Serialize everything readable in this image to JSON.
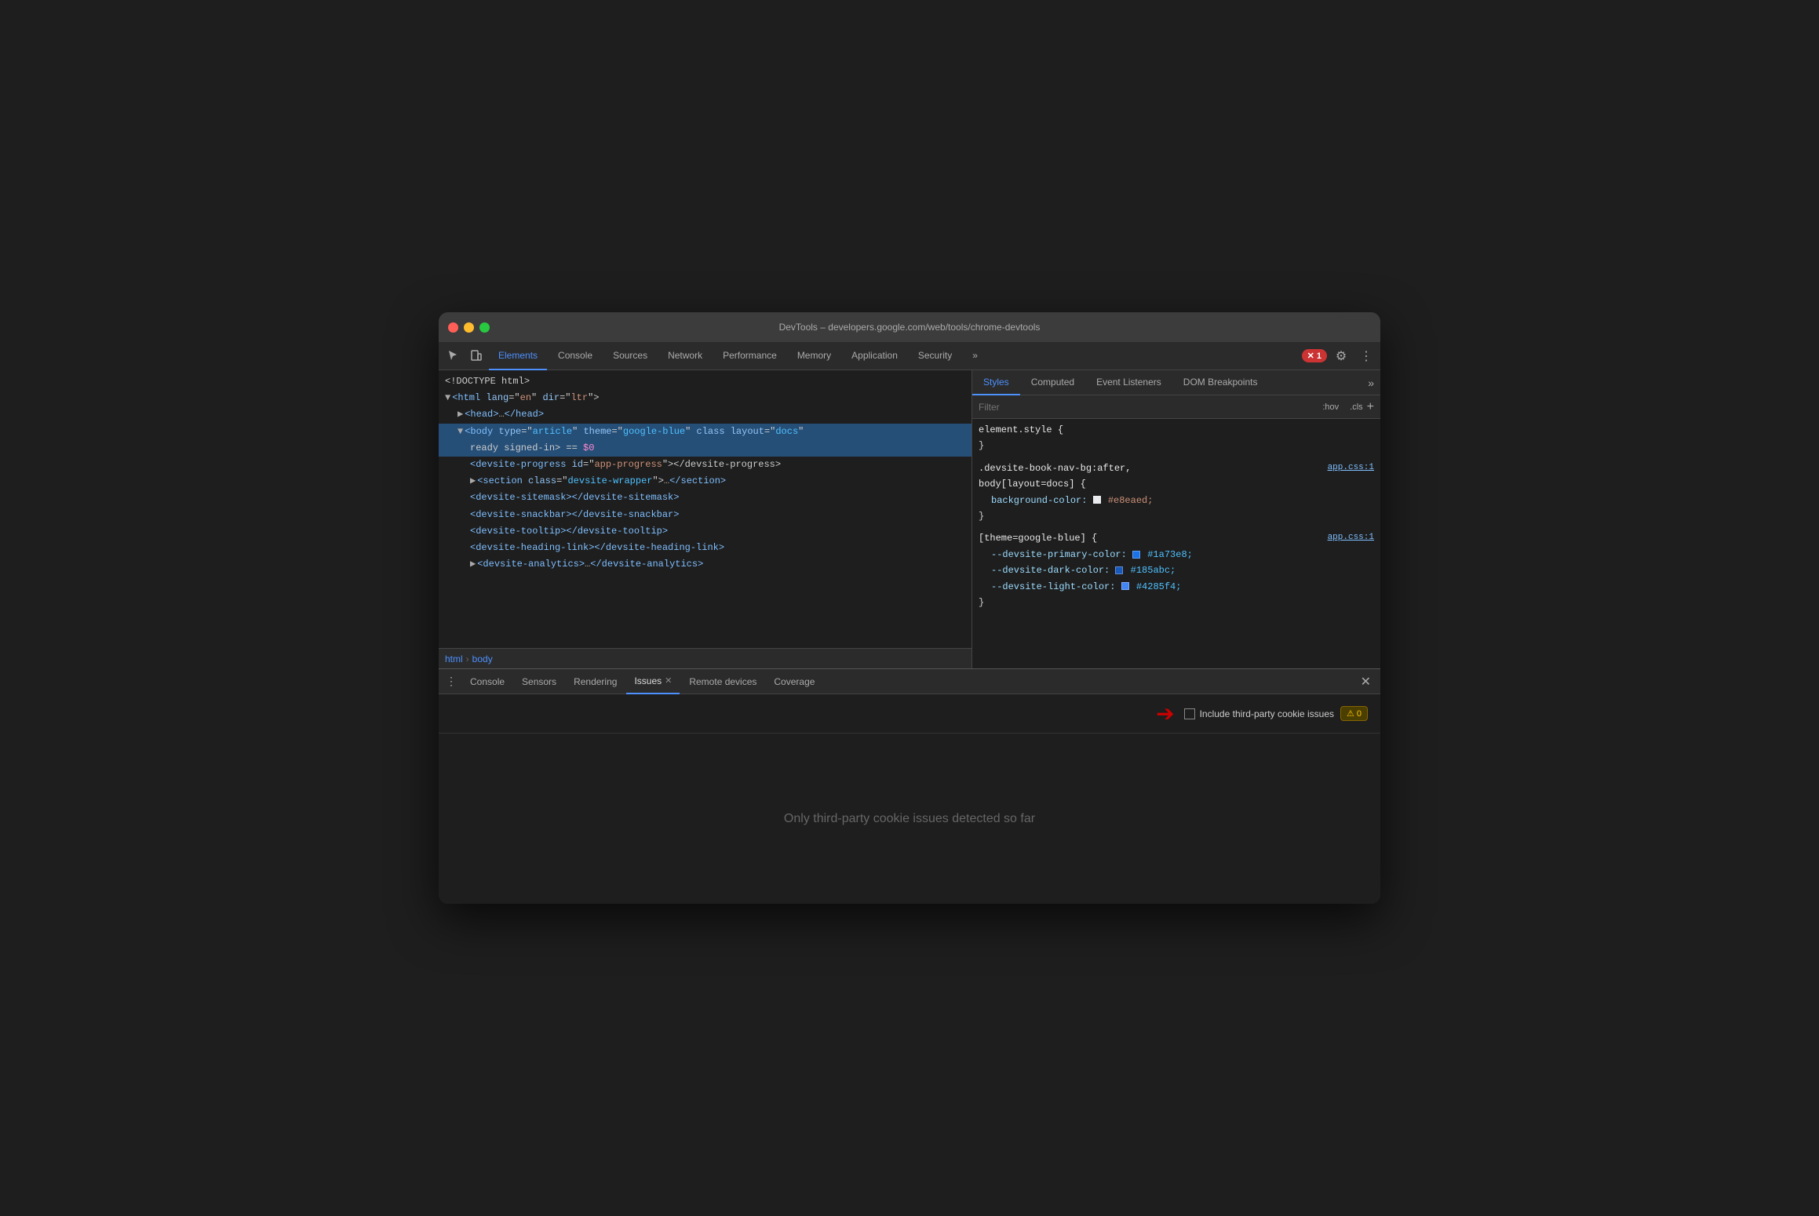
{
  "window": {
    "title": "DevTools – developers.google.com/web/tools/chrome-devtools"
  },
  "nav": {
    "tabs": [
      {
        "label": "Elements",
        "active": true
      },
      {
        "label": "Console",
        "active": false
      },
      {
        "label": "Sources",
        "active": false
      },
      {
        "label": "Network",
        "active": false
      },
      {
        "label": "Performance",
        "active": false
      },
      {
        "label": "Memory",
        "active": false
      },
      {
        "label": "Application",
        "active": false
      },
      {
        "label": "Security",
        "active": false
      }
    ],
    "more_label": "»",
    "error_count": "1",
    "settings_icon": "⚙",
    "more_vert_icon": "⋮"
  },
  "elements": {
    "lines": [
      {
        "text": "<!DOCTYPE html>",
        "type": "doctype",
        "indent": 0
      },
      {
        "text": "<html lang=\"en\" dir=\"ltr\">",
        "type": "tag",
        "indent": 0,
        "has_triangle": true,
        "triangle_open": true
      },
      {
        "text": "▶ <head>…</head>",
        "type": "tag_collapsed",
        "indent": 1
      },
      {
        "text": "<body type=\"article\" theme=\"google-blue\" class layout=\"docs\"",
        "type": "tag_selected",
        "indent": 1,
        "has_triangle": true,
        "triangle_open": true
      },
      {
        "text": "ready signed-in> == $0",
        "type": "tag_selected_cont",
        "indent": 2
      },
      {
        "text": "<devsite-progress id=\"app-progress\"></devsite-progress>",
        "type": "tag",
        "indent": 3
      },
      {
        "text": "▶ <section class=\"devsite-wrapper\">…</section>",
        "type": "tag_collapsed",
        "indent": 3
      },
      {
        "text": "<devsite-sitemask></devsite-sitemask>",
        "type": "tag",
        "indent": 3
      },
      {
        "text": "<devsite-snackbar></devsite-snackbar>",
        "type": "tag",
        "indent": 3
      },
      {
        "text": "<devsite-tooltip></devsite-tooltip>",
        "type": "tag",
        "indent": 3
      },
      {
        "text": "<devsite-heading-link></devsite-heading-link>",
        "type": "tag",
        "indent": 3
      },
      {
        "text": "▶ <devsite-analytics>…</devsite-analytics>",
        "type": "tag_collapsed",
        "indent": 3
      }
    ],
    "breadcrumb": [
      "html",
      "body"
    ]
  },
  "styles": {
    "tabs": [
      {
        "label": "Styles",
        "active": true
      },
      {
        "label": "Computed",
        "active": false
      },
      {
        "label": "Event Listeners",
        "active": false
      },
      {
        "label": "DOM Breakpoints",
        "active": false
      }
    ],
    "filter_placeholder": "Filter",
    "hov_label": ":hov",
    "cls_label": ".cls",
    "add_label": "+",
    "rules": [
      {
        "selector": "element.style {",
        "close": "}",
        "file": null,
        "properties": []
      },
      {
        "selector": ".devsite-book-nav-bg:after,\nbody[layout=docs] {",
        "close": "}",
        "file": "app.css:1",
        "properties": [
          {
            "name": "background-color:",
            "value": "#e8eaed",
            "color": "#e8eaed"
          }
        ]
      },
      {
        "selector": "[theme=google-blue] {",
        "close": "}",
        "file": "app.css:1",
        "properties": [
          {
            "name": "--devsite-primary-color:",
            "value": "#1a73e8",
            "color": "#1a73e8"
          },
          {
            "name": "--devsite-dark-color:",
            "value": "#185abc",
            "color": "#185abc"
          },
          {
            "name": "--devsite-light-color:",
            "value": "#4285f4",
            "color": "#4285f4"
          }
        ]
      }
    ]
  },
  "drawer": {
    "tabs": [
      {
        "label": "Console",
        "active": false,
        "closeable": false
      },
      {
        "label": "Sensors",
        "active": false,
        "closeable": false
      },
      {
        "label": "Rendering",
        "active": false,
        "closeable": false
      },
      {
        "label": "Issues",
        "active": true,
        "closeable": true
      },
      {
        "label": "Remote devices",
        "active": false,
        "closeable": false
      },
      {
        "label": "Coverage",
        "active": false,
        "closeable": false
      }
    ],
    "checkbox_label": "Include third-party cookie issues",
    "warning_count": "0",
    "empty_message": "Only third-party cookie issues detected so far"
  }
}
